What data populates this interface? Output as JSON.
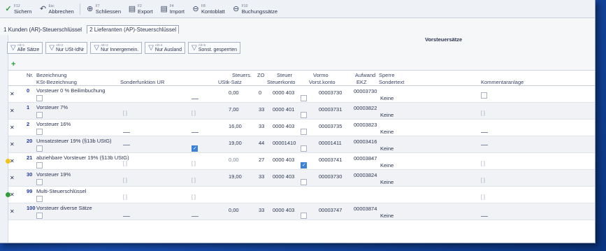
{
  "toolbar": {
    "buttons": [
      {
        "key": "F12",
        "label": "Sichern",
        "icon": "check-icon"
      },
      {
        "key": "Esc",
        "label": "Abbrechen",
        "icon": "undo-icon"
      },
      {
        "key": "F7",
        "label": "Schliessen",
        "icon": "close-circle-icon"
      },
      {
        "key": "F2",
        "label": "Export",
        "icon": "export-icon"
      },
      {
        "key": "F4",
        "label": "Import",
        "icon": "import-icon"
      },
      {
        "key": "F8",
        "label": "Kontoblatt",
        "icon": "ledger-icon"
      },
      {
        "key": "F10",
        "label": "Buchungssätze",
        "icon": "bookings-icon"
      }
    ]
  },
  "tabs": [
    {
      "label": "1 Kunden (AR)-Steuerschlüssel",
      "active": false
    },
    {
      "label": "2 Lieferanten (AP)-Steuerschlüssel",
      "active": true
    }
  ],
  "section_title": "Vorsteuersätze",
  "filters": [
    {
      "key": "Alt+1",
      "label": "Alle Sätze"
    },
    {
      "key": "Alt+2",
      "label": "Nur USt-IdNr"
    },
    {
      "key": "Alt+3",
      "label": "Nur Innergemein."
    },
    {
      "key": "Alt+4",
      "label": "Nur Ausland"
    },
    {
      "key": "Alt+5",
      "label": "Sonst. gesperrten"
    }
  ],
  "columns": {
    "nr": "Nr.",
    "bezeichnung": "Bezeichnung",
    "bez2": "KSt-Bezeichnung",
    "sonder": "Sonderfunktion UR",
    "steuersatz": "Steuers.",
    "ust_satz": "UStk-Satz",
    "steuer": "Steuer",
    "zo": "ZO",
    "steuerkonto": "Steuerkonto",
    "vormerk": "Vormo",
    "vstkonto": "Vorst.konto",
    "aufwand": "Aufwand",
    "ekz": "EKZ",
    "sperre": "Sperre",
    "sonder2": "Sondertext",
    "kommentar": "Kommentaranlage"
  },
  "rows": [
    {
      "nr": "0",
      "bez": "Vorsteuer 0 % Beilimbuchung",
      "satz": "0,00",
      "zo": "0",
      "sk": "0000 403",
      "vk": "00003730",
      "ek": "00003730",
      "sperre": "Keine",
      "cb": false
    },
    {
      "nr": "1",
      "bez": "Vorsteuer 7%",
      "satz": "7,00",
      "zo": "33",
      "sk": "0000 401",
      "vk": "00003731",
      "ek": "00003822",
      "sperre": "Keine",
      "cb": false
    },
    {
      "nr": "2",
      "bez": "Vorsteuer 16%",
      "satz": "16,00",
      "zo": "33",
      "sk": "0000 403",
      "vk": "00003735",
      "ek": "00003823",
      "sperre": "Keine",
      "cb": false
    },
    {
      "nr": "20",
      "bez": "Umsatzsteuer 19% (§13b UStG)",
      "satz": "19,00",
      "zo": "44",
      "sk": "00001410",
      "vk": "00001411",
      "ek": "00003416",
      "sperre": "Keine",
      "cb": true
    },
    {
      "nr": "21",
      "bez": "abziehbare Vorsteuer 19% (§13b UStG)",
      "satz": "0,00",
      "zo": "27",
      "sk": "0000 403",
      "vk": "00003741",
      "ek": "00003847",
      "sperre": "Keine",
      "cb": false
    },
    {
      "nr": "30",
      "bez": "Vorsteuer 19%",
      "satz": "19,00",
      "zo": "33",
      "sk": "0000 403",
      "vk": "00003730",
      "ek": "00003824",
      "sperre": "Keine",
      "cb": false
    },
    {
      "nr": "99",
      "bez": "Multi-Steuerschlüssel",
      "satz": "",
      "zo": "",
      "sk": "",
      "vk": "",
      "ek": "",
      "sperre": "",
      "cb": false
    },
    {
      "nr": "100",
      "bez": "Vorsteuer diverse Sätze",
      "satz": "0,00",
      "zo": "33",
      "sk": "0000 403",
      "vk": "00003747",
      "ek": "00003874",
      "sperre": "Keine",
      "cb": false
    }
  ],
  "colors": {
    "accent_green": "#2f9e3a",
    "nr_blue": "#1f3a9a",
    "check_blue": "#3b82d6"
  }
}
